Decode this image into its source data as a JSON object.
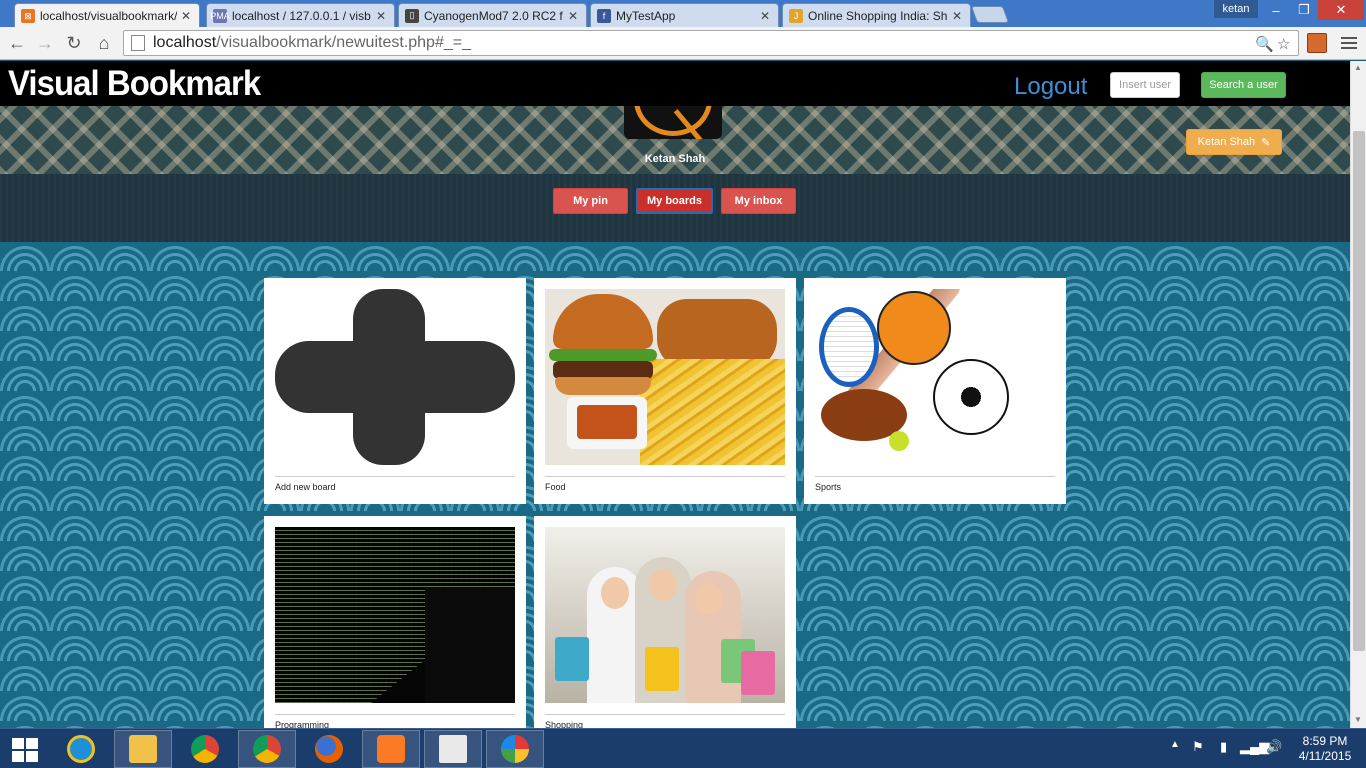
{
  "browser": {
    "tabs": [
      {
        "label": "localhost/visualbookmark/",
        "favicon_color": "#e87722",
        "active": true
      },
      {
        "label": "localhost / 127.0.0.1 / visb",
        "favicon_color": "#6c78af",
        "favicon_text": "PMA",
        "active": false
      },
      {
        "label": "CyanogenMod7 2.0 RC2 f",
        "favicon_color": "#444444",
        "active": false
      },
      {
        "label": "MyTestApp",
        "favicon_color": "#3b5998",
        "favicon_text": "f",
        "active": false
      },
      {
        "label": "Online Shopping India: Sh",
        "favicon_color": "#e0a52f",
        "favicon_text": "J",
        "active": false
      }
    ],
    "user_chip": "ketan",
    "url_host": "localhost",
    "url_rest": "/visualbookmark/newuitest.php#_=_"
  },
  "site": {
    "brand": "Visual Bookmark",
    "logout": "Logout",
    "insert_user": "Insert user",
    "search_user": "Search a user",
    "username": "Ketan Shah",
    "edit_profile": "Ketan Shah",
    "nav": {
      "my_pin": "My pin",
      "my_boards": "My boards",
      "my_inbox": "My inbox"
    },
    "active_nav": "my_boards"
  },
  "boards": [
    {
      "label": "Add new board",
      "thumb": "add"
    },
    {
      "label": "Food",
      "thumb": "food"
    },
    {
      "label": "Sports",
      "thumb": "sports"
    },
    {
      "label": "Programming",
      "thumb": "code"
    },
    {
      "label": "Shopping",
      "thumb": "shop"
    }
  ],
  "taskbar": {
    "apps": [
      "internet-explorer",
      "file-explorer",
      "chrome-canary",
      "chrome",
      "firefox",
      "xampp",
      "notepad",
      "paint"
    ],
    "time": "8:59 PM",
    "date": "4/11/2015"
  }
}
